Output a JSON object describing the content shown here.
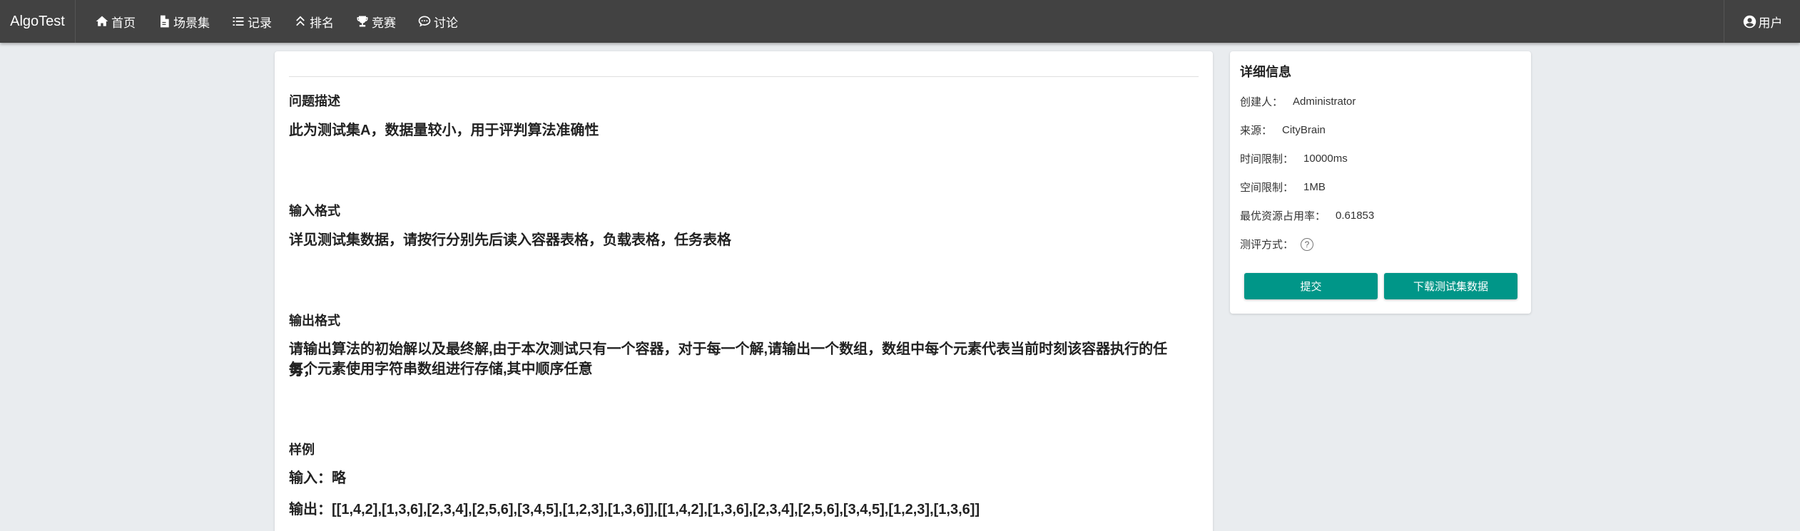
{
  "navbar": {
    "brand": "AlgoTest",
    "items": [
      {
        "label": "首页",
        "icon": "home-icon"
      },
      {
        "label": "场景集",
        "icon": "document-icon"
      },
      {
        "label": "记录",
        "icon": "list-icon"
      },
      {
        "label": "排名",
        "icon": "rank-icon"
      },
      {
        "label": "竞赛",
        "icon": "trophy-icon"
      },
      {
        "label": "讨论",
        "icon": "chat-icon"
      }
    ],
    "user": {
      "label": "用户",
      "icon": "user-circle-icon"
    }
  },
  "problem": {
    "description_title": "问题描述",
    "description": "此为测试集A，数据量较小，用于评判算法准确性",
    "input_title": "输入格式",
    "input": "详见测试集数据，请按行分别先后读入容器表格，负载表格，任务表格",
    "output_title": "输出格式",
    "output_line1": "请输出算法的初始解以及最终解,由于本次测试只有一个容器，对于每一个解,请输出一个数组，数组中每个元素代表当前时刻该容器执行的任务，",
    "output_line2": "每个元素使用字符串数组进行存储,其中顺序任意",
    "sample_title": "样例",
    "sample_input": "输入：略",
    "sample_output": "输出：[[1,4,2],[1,3,6],[2,3,4],[2,5,6],[3,4,5],[1,2,3],[1,3,6]],[[1,4,2],[1,3,6],[2,3,4],[2,5,6],[3,4,5],[1,2,3],[1,3,6]]"
  },
  "details": {
    "title": "详细信息",
    "creator_label": "创建人：",
    "creator": "Administrator",
    "source_label": "来源：",
    "source": "CityBrain",
    "time_label": "时间限制：",
    "time": "10000ms",
    "space_label": "空间限制：",
    "space": "1MB",
    "best_label": "最优资源占用率：",
    "best": "0.61853",
    "eval_label": "测评方式：",
    "help_icon_text": "?",
    "submit_label": "提交",
    "download_label": "下载测试集数据",
    "accent_color": "#009688"
  }
}
